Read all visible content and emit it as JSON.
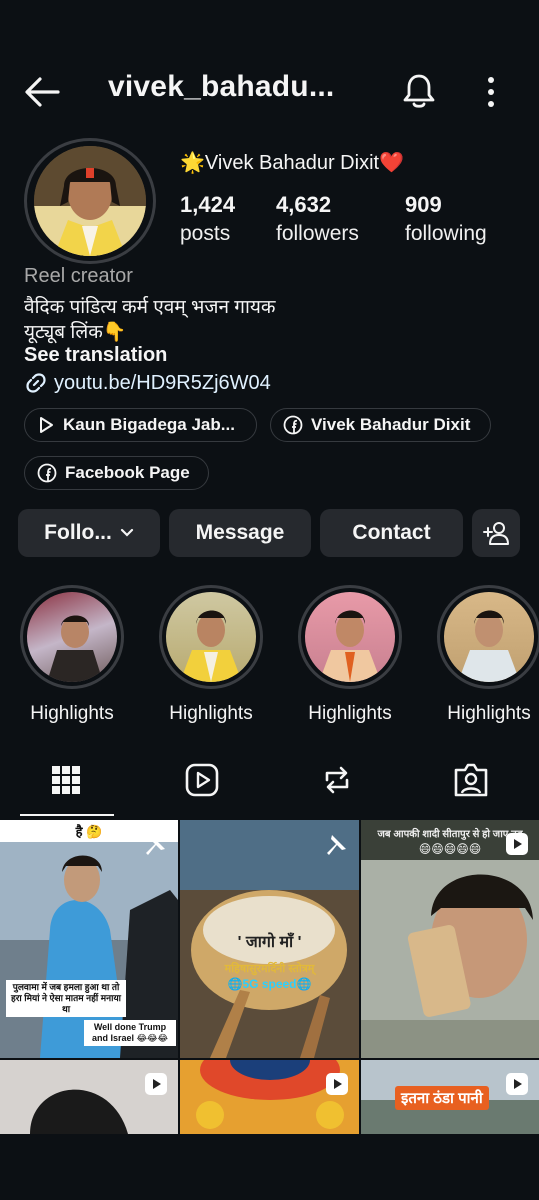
{
  "header": {
    "username": "vivek_bahadu...",
    "back_icon": "arrow-left-icon",
    "bell_icon": "bell-icon",
    "more_icon": "kebab-menu-icon"
  },
  "profile": {
    "display_name": "🌟Vivek Bahadur Dixit❤️",
    "stats": [
      {
        "value": "1,424",
        "label": "posts"
      },
      {
        "value": "4,632",
        "label": "followers"
      },
      {
        "value": "909",
        "label": "following"
      }
    ],
    "category": "Reel creator",
    "bio_lines": [
      "वैदिक पांडित्य कर्म एवम् भजन गायक",
      "यूट्यूब लिंक👇"
    ],
    "see_translation": "See translation",
    "link": "youtu.be/HD9R5Zj6W04"
  },
  "chips": [
    {
      "label": "Kaun Bigadega Jab...",
      "icon": "play-circle-icon"
    },
    {
      "label": "Vivek Bahadur Dixit",
      "icon": "facebook-icon"
    },
    {
      "label": "Facebook Page",
      "icon": "facebook-icon"
    }
  ],
  "actions": {
    "follow": "Follo...",
    "message": "Message",
    "contact": "Contact",
    "add_user_icon": "add-person-icon"
  },
  "highlights": [
    {
      "label": "Highlights"
    },
    {
      "label": "Highlights"
    },
    {
      "label": "Highlights"
    },
    {
      "label": "Highlights"
    }
  ],
  "tabs": [
    "grid-icon",
    "reels-icon",
    "reposts-icon",
    "tagged-icon"
  ],
  "grid": {
    "post1": {
      "top_text": "है 🤔",
      "caption": "पुलवामा में जब हमला हुआ था तो हरा मियां ने ऐसा मातम नहीं मनाया था",
      "caption2": "Well done Trump and Israel 😂😂😂"
    },
    "post2": {
      "title": "' जागो माँ '",
      "subtitle": "महिषासुरमर्दिनी स्तोत्रम्",
      "badge": "🌐5G speed🌐"
    },
    "post3": {
      "top_text": "जब आपकी शादी सीतापुर से हो जाए तब",
      "emojis": "😄😄😄😄😄"
    },
    "post6": {
      "banner": "इतना ठंडा पानी"
    }
  },
  "colors": {
    "bg": "#0c1014",
    "button": "#26292e",
    "link": "#e0f1ff",
    "muted": "#a8a8a8"
  }
}
